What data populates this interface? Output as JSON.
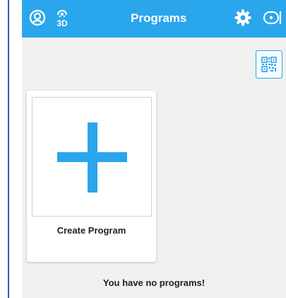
{
  "appbar": {
    "title": "Programs",
    "background": "#2aa6ec",
    "left_icons": [
      "account-circle-icon",
      "3d-view-icon"
    ],
    "right_icons": [
      "gear-icon",
      "robot-icon"
    ]
  },
  "toolbar": {
    "qr_icon": "qr-code-icon"
  },
  "programs": {
    "create_card_label": "Create Program",
    "create_icon": "plus-icon",
    "accent": "#2aa6ec",
    "empty_message": "You have no programs!"
  }
}
